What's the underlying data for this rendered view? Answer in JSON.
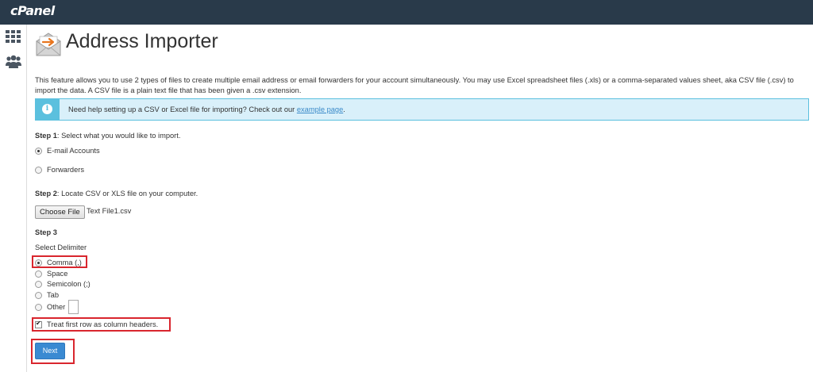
{
  "app": {
    "logo": "cPanel"
  },
  "sidebar": {
    "items": [
      {
        "icon": "grid-icon"
      },
      {
        "icon": "users-icon"
      }
    ]
  },
  "page": {
    "title": "Address Importer",
    "description": "This feature allows you to use 2 types of files to create multiple email address or email forwarders for your account simultaneously. You may use Excel spreadsheet files (.xls) or a comma-separated values sheet, aka CSV file (.csv) to import the data. A CSV file is a plain text file that has been given a .csv extension."
  },
  "info": {
    "text": "Need help setting up a CSV or Excel file for importing? Check out our ",
    "link": "example page",
    "suffix": "."
  },
  "step1": {
    "label": "Step 1",
    "text": ": Select what you would like to import.",
    "options": [
      {
        "label": "E-mail Accounts",
        "checked": true
      },
      {
        "label": "Forwarders",
        "checked": false
      }
    ]
  },
  "step2": {
    "label": "Step 2",
    "text": ": Locate CSV or XLS file on your computer.",
    "button": "Choose File",
    "file": "Text File1.csv"
  },
  "step3": {
    "label": "Step 3",
    "subtitle": "Select Delimiter",
    "delimiters": [
      {
        "label": "Comma (,)",
        "checked": true
      },
      {
        "label": "Space",
        "checked": false
      },
      {
        "label": "Semicolon (;)",
        "checked": false
      },
      {
        "label": "Tab",
        "checked": false
      },
      {
        "label": "Other",
        "checked": false
      }
    ],
    "other_value": "",
    "header_checkbox": {
      "label": "Treat first row as column headers.",
      "checked": true
    }
  },
  "actions": {
    "next": "Next"
  },
  "colors": {
    "topbar": "#293a4a",
    "info_bg": "#d9f0fa",
    "info_accent": "#5bc0de",
    "button": "#3a8ad2",
    "highlight": "#d9262e"
  }
}
